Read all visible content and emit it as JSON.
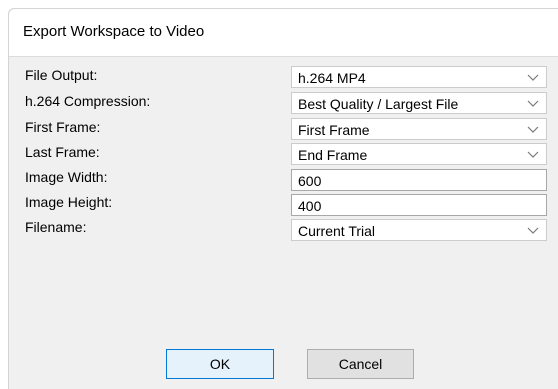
{
  "window": {
    "title": "Export Workspace to Video"
  },
  "form": {
    "rows": [
      {
        "label": "File Output:",
        "type": "select",
        "value": "h.264 MP4"
      },
      {
        "label": "h.264 Compression:",
        "type": "select",
        "value": "Best Quality / Largest File"
      },
      {
        "label": "First Frame:",
        "type": "select",
        "value": "First Frame"
      },
      {
        "label": "Last Frame:",
        "type": "select",
        "value": "End Frame"
      },
      {
        "label": "Image Width:",
        "type": "text",
        "value": "600"
      },
      {
        "label": "Image Height:",
        "type": "text",
        "value": "400"
      },
      {
        "label": "Filename:",
        "type": "select",
        "value": "Current Trial"
      }
    ]
  },
  "buttons": {
    "ok_label": "OK",
    "cancel_label": "Cancel"
  },
  "icons": {
    "dropdown": "chevron-down-icon"
  },
  "colors": {
    "focus_border": "#0078d7",
    "dialog_bg": "#f0f0f0"
  }
}
